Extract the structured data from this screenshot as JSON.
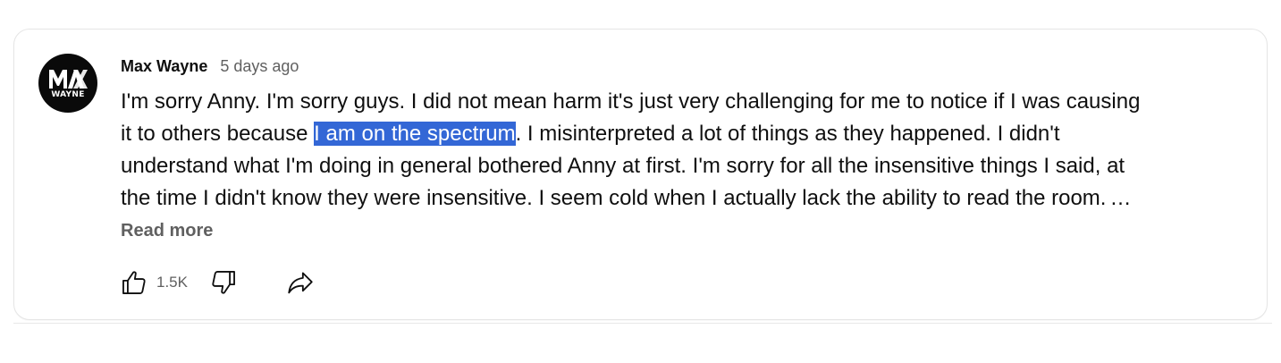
{
  "comment": {
    "author": "Max Wayne",
    "time": "5 days ago",
    "avatar_text": "WAYNE",
    "lines": [
      {
        "before": "I'm sorry Anny. I'm sorry guys. I did not mean harm it's just very challenging for me to notice if I was causing",
        "highlight": "",
        "after": ""
      },
      {
        "before": "it to others because ",
        "highlight": "I am on the spectrum",
        "after": ". I misinterpreted a lot of things as they happened. I didn't"
      },
      {
        "before": "understand what I'm doing in general bothered Anny at first. I'm sorry for all the insensitive things I said, at",
        "highlight": "",
        "after": ""
      },
      {
        "before": "the time I didn't know they were insensitive. I seem cold when I actually lack the ability to read the room.",
        "highlight": "",
        "after": ""
      }
    ],
    "ellipsis": "…",
    "read_more": "Read more",
    "like_count": "1.5K"
  },
  "icons": {
    "avatar": "max-wayne-logo",
    "like": "thumbs-up-icon",
    "dislike": "thumbs-down-icon",
    "share": "share-arrow-icon"
  },
  "colors": {
    "selection_highlight": "#3367d6",
    "secondary_text": "#606060",
    "primary_text": "#0f0f0f",
    "card_border": "#e5e5e5"
  }
}
